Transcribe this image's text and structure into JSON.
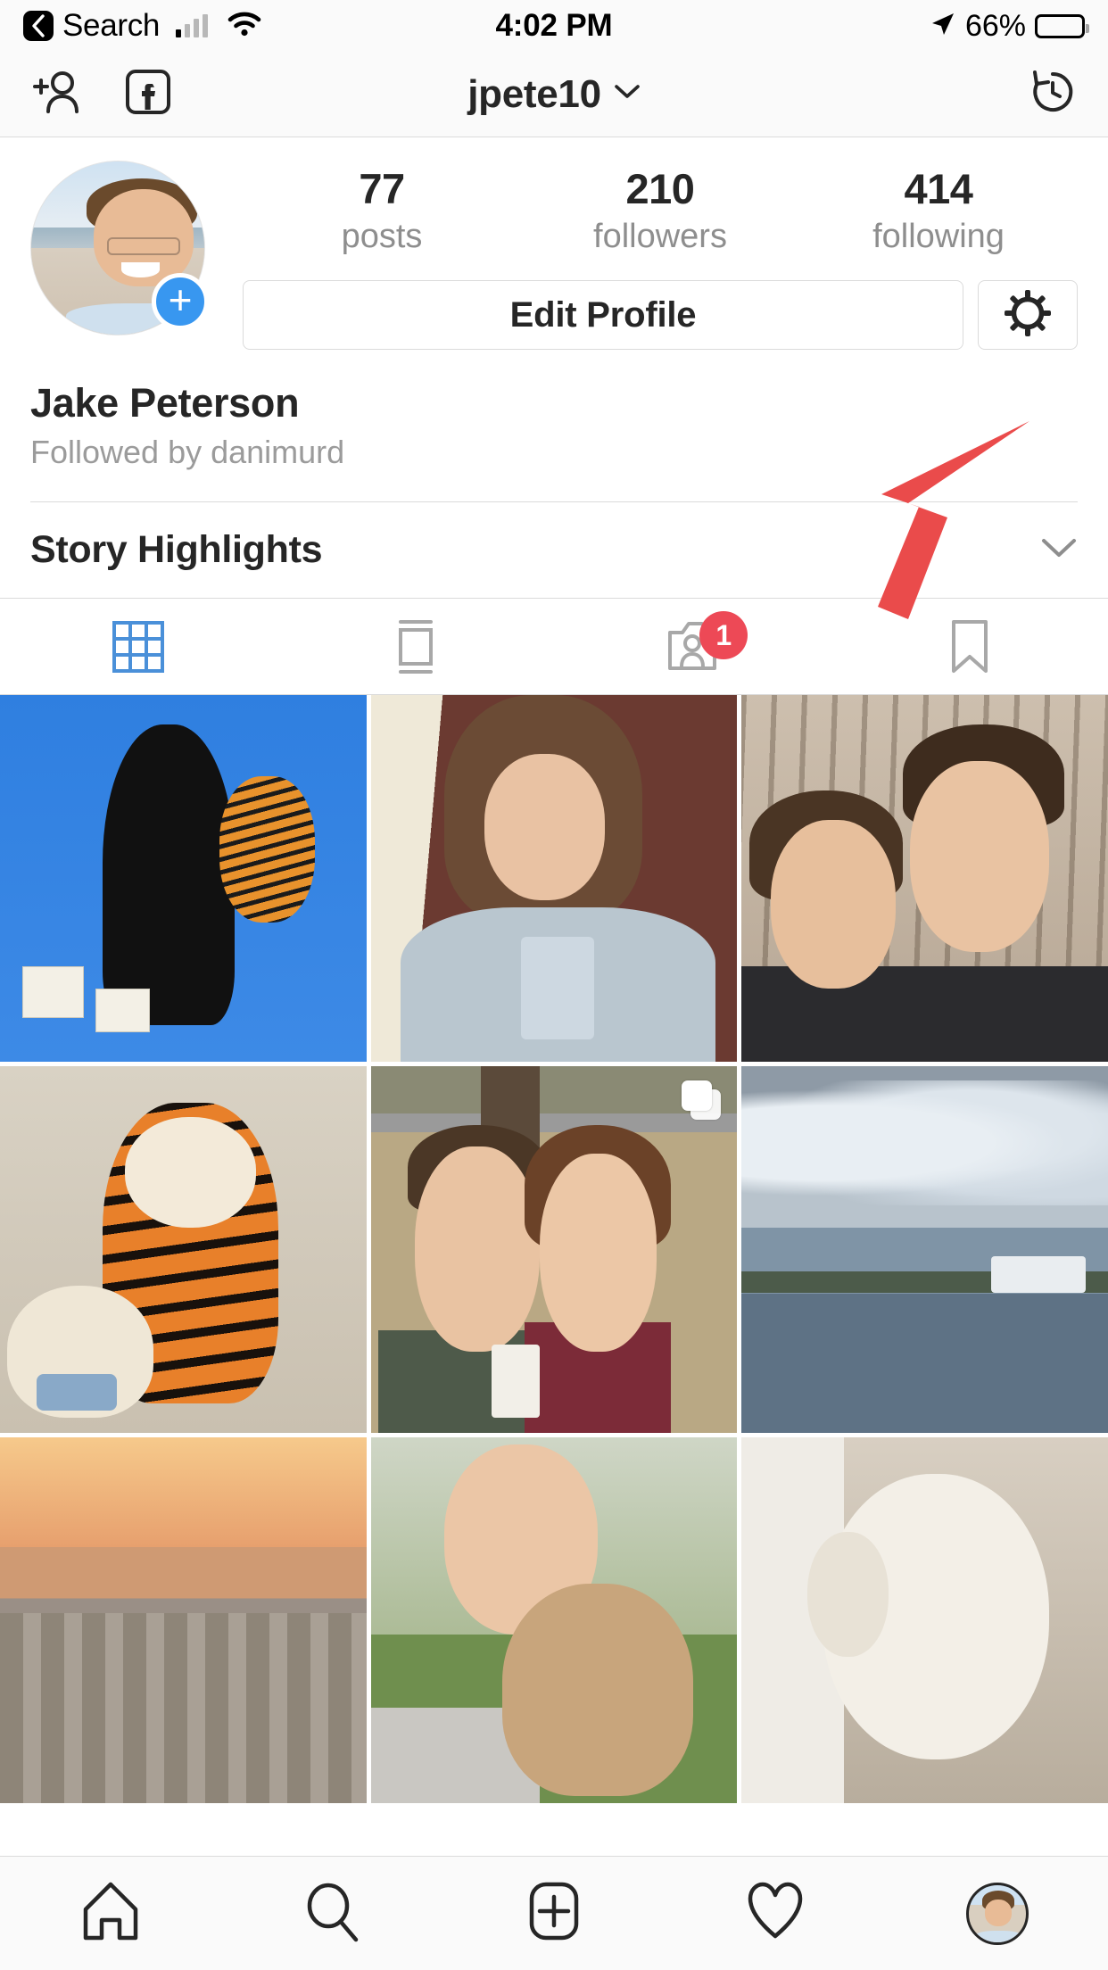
{
  "status_bar": {
    "back_label": "Search",
    "time": "4:02 PM",
    "battery_percent": "66%",
    "back_icon": "chevron-left-icon",
    "signal_icon": "cellular-bars-icon",
    "wifi_icon": "wifi-icon",
    "location_icon": "location-arrow-icon",
    "battery_icon": "battery-icon"
  },
  "nav_bar": {
    "add_person_icon": "add-person-icon",
    "facebook_icon": "facebook-icon",
    "title": "jpete10",
    "title_chevron_icon": "chevron-down-icon",
    "history_icon": "archive-history-icon"
  },
  "profile": {
    "avatar_icon": "profile-avatar",
    "avatar_add_badge": "+",
    "stats": [
      {
        "number": "77",
        "label": "posts"
      },
      {
        "number": "210",
        "label": "followers"
      },
      {
        "number": "414",
        "label": "following"
      }
    ],
    "edit_profile_label": "Edit Profile",
    "settings_icon": "gear-icon",
    "full_name": "Jake Peterson",
    "followed_by": "Followed by danimurd"
  },
  "story_highlights": {
    "title": "Story Highlights",
    "chevron_icon": "chevron-down-icon"
  },
  "tabs": [
    {
      "name": "grid-tab",
      "icon": "grid-icon",
      "active": true,
      "badge": ""
    },
    {
      "name": "list-tab",
      "icon": "list-view-icon",
      "active": false,
      "badge": ""
    },
    {
      "name": "tagged-tab",
      "icon": "tagged-photos-icon",
      "active": false,
      "badge": "1"
    },
    {
      "name": "saved-tab",
      "icon": "bookmark-icon",
      "active": false,
      "badge": ""
    }
  ],
  "grid": {
    "cells": [
      {
        "name": "post-1",
        "alt": "blue mural of figure with tiger",
        "multi": false
      },
      {
        "name": "post-2",
        "alt": "woman drinking from glass",
        "multi": false
      },
      {
        "name": "post-3",
        "alt": "couple selfie outdoors in winter",
        "multi": false
      },
      {
        "name": "post-4",
        "alt": "crocheted tiger plush toy",
        "multi": false
      },
      {
        "name": "post-5",
        "alt": "couple with coffee by a tree",
        "multi": true
      },
      {
        "name": "post-6",
        "alt": "cloudy sky over harbor water",
        "multi": false
      },
      {
        "name": "post-7",
        "alt": "city skyline at sunset",
        "multi": false
      },
      {
        "name": "post-8",
        "alt": "woman with dog on grass",
        "multi": false
      },
      {
        "name": "post-9",
        "alt": "white bichon dog by window",
        "multi": false
      }
    ]
  },
  "bottom_nav": [
    {
      "name": "home-tab",
      "icon": "home-icon"
    },
    {
      "name": "search-tab",
      "icon": "search-icon"
    },
    {
      "name": "add-post-tab",
      "icon": "plus-square-icon"
    },
    {
      "name": "activity-tab",
      "icon": "heart-icon"
    },
    {
      "name": "profile-tab",
      "icon": "profile-avatar-icon"
    }
  ],
  "annotation": {
    "arrow_icon": "red-pointer-arrow",
    "color": "#ea4b4b"
  },
  "colors": {
    "accent_blue": "#3897f0",
    "badge_red": "#ed4956",
    "text_primary": "#262626",
    "text_secondary": "#8e8e8e",
    "border": "#dbdbdb",
    "chrome_bg": "#fafafa"
  }
}
